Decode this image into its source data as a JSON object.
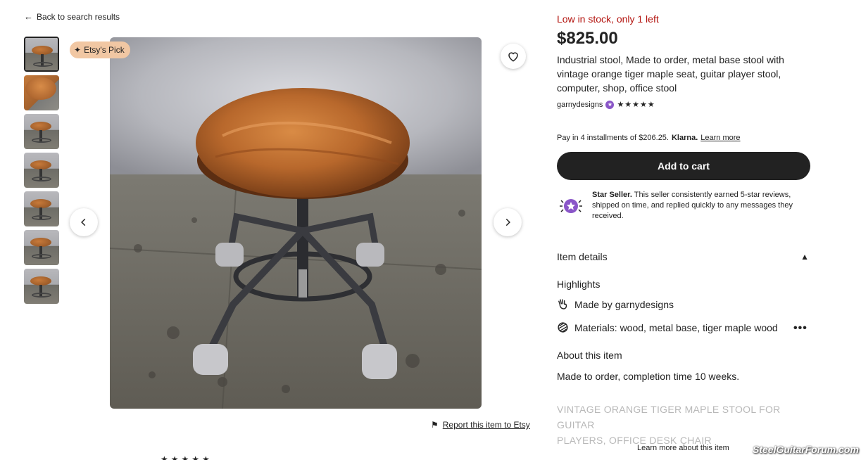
{
  "nav": {
    "back_label": "Back to search results"
  },
  "gallery": {
    "badge_label": "Etsy's Pick",
    "thumbnail_count": 7
  },
  "report_label": "Report this item to Etsy",
  "listing": {
    "stock_status": "Low in stock, only 1 left",
    "price": "$825.00",
    "title": "Industrial stool, Made to order, metal base stool with vintage orange tiger maple seat, guitar player stool, computer, shop, office stool",
    "seller_name": "garnydesigns",
    "rating_stars": "★★★★★",
    "installments_text": "Pay in 4 installments of $206.25.",
    "klarna_label": "Klarna.",
    "learn_more_label": "Learn more",
    "add_to_cart_label": "Add to cart",
    "star_seller_title": "Star Seller.",
    "star_seller_text": "This seller consistently earned 5-star reviews, shipped on time, and replied quickly to any messages they received."
  },
  "details": {
    "header": "Item details",
    "highlights_header": "Highlights",
    "made_by_prefix": "Made by",
    "made_by_seller": "garnydesigns",
    "materials": "Materials: wood, metal base, tiger maple wood",
    "about_header": "About this item",
    "about_text": "Made to order, completion time 10 weeks.",
    "description_line1": "VINTAGE ORANGE TIGER MAPLE STOOL FOR GUITAR",
    "description_line2": "PLAYERS, OFFICE DESK CHAIR",
    "learn_more_item_label": "Learn more about this item"
  },
  "watermark": "SteelGuitarForum.com",
  "colors": {
    "stock_red": "#b3130e",
    "button_dark": "#222222",
    "badge_peach": "#f1c7a3",
    "star_seller_purple": "#8a56c8"
  }
}
